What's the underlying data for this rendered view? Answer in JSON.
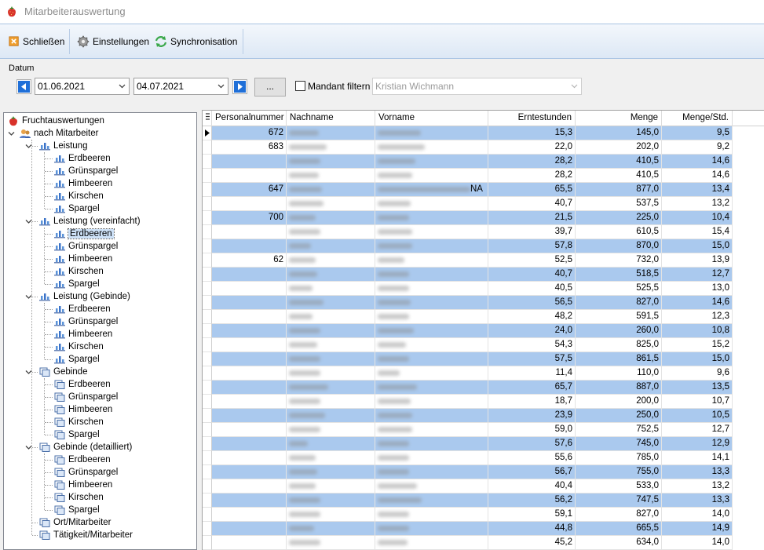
{
  "window": {
    "title": "Mitarbeiterauswertung"
  },
  "toolbar": {
    "close_label": "Schließen",
    "settings_label": "Einstellungen",
    "sync_label": "Synchronisation"
  },
  "filter": {
    "datum_label": "Datum",
    "date_from": "01.06.2021",
    "date_to": "04.07.2021",
    "dots_label": "...",
    "mandant_label": "Mandant filtern",
    "mandant_checked": false,
    "mandant_value": "Kristian Wichmann"
  },
  "tree": {
    "root": "Fruchtauswertungen",
    "by_employee": "nach Mitarbeiter",
    "groups": [
      {
        "label": "Leistung",
        "items": [
          "Erdbeeren",
          "Grünspargel",
          "Himbeeren",
          "Kirschen",
          "Spargel"
        ]
      },
      {
        "label": "Leistung (vereinfacht)",
        "items": [
          "Erdbeeren",
          "Grünspargel",
          "Himbeeren",
          "Kirschen",
          "Spargel"
        ]
      },
      {
        "label": "Leistung (Gebinde)",
        "items": [
          "Erdbeeren",
          "Grünspargel",
          "Himbeeren",
          "Kirschen",
          "Spargel"
        ]
      },
      {
        "label": "Gebinde",
        "items": [
          "Erdbeeren",
          "Grünspargel",
          "Himbeeren",
          "Kirschen",
          "Spargel"
        ]
      },
      {
        "label": "Gebinde (detailliert)",
        "items": [
          "Erdbeeren",
          "Grünspargel",
          "Himbeeren",
          "Kirschen",
          "Spargel"
        ]
      }
    ],
    "extra": [
      "Ort/Mitarbeiter",
      "Tätigkeit/Mitarbeiter"
    ],
    "selected_item": "Erdbeeren"
  },
  "grid": {
    "columns": [
      "Personalnummer",
      "Nachname",
      "Vorname",
      "Erntestunden",
      "Menge",
      "Menge/Std."
    ],
    "rows": [
      {
        "pnr": "672",
        "vorname_suffix": "",
        "stunden": "15,3",
        "menge": "145,0",
        "mps": "9,5"
      },
      {
        "pnr": "683",
        "vorname_suffix": "",
        "stunden": "22,0",
        "menge": "202,0",
        "mps": "9,2"
      },
      {
        "pnr": "",
        "vorname_suffix": "",
        "stunden": "28,2",
        "menge": "410,5",
        "mps": "14,6"
      },
      {
        "pnr": "",
        "vorname_suffix": "",
        "stunden": "28,2",
        "menge": "410,5",
        "mps": "14,6"
      },
      {
        "pnr": "647",
        "vorname_suffix": "NA",
        "stunden": "65,5",
        "menge": "877,0",
        "mps": "13,4"
      },
      {
        "pnr": "",
        "vorname_suffix": "",
        "stunden": "40,7",
        "menge": "537,5",
        "mps": "13,2"
      },
      {
        "pnr": "700",
        "vorname_suffix": "",
        "stunden": "21,5",
        "menge": "225,0",
        "mps": "10,4"
      },
      {
        "pnr": "",
        "vorname_suffix": "",
        "stunden": "39,7",
        "menge": "610,5",
        "mps": "15,4"
      },
      {
        "pnr": "",
        "vorname_suffix": "",
        "stunden": "57,8",
        "menge": "870,0",
        "mps": "15,0"
      },
      {
        "pnr": "62",
        "vorname_suffix": "",
        "stunden": "52,5",
        "menge": "732,0",
        "mps": "13,9"
      },
      {
        "pnr": "",
        "vorname_suffix": "",
        "stunden": "40,7",
        "menge": "518,5",
        "mps": "12,7"
      },
      {
        "pnr": "",
        "vorname_suffix": "",
        "stunden": "40,5",
        "menge": "525,5",
        "mps": "13,0"
      },
      {
        "pnr": "",
        "vorname_suffix": "",
        "stunden": "56,5",
        "menge": "827,0",
        "mps": "14,6"
      },
      {
        "pnr": "",
        "vorname_suffix": "",
        "stunden": "48,2",
        "menge": "591,5",
        "mps": "12,3"
      },
      {
        "pnr": "",
        "vorname_suffix": "",
        "stunden": "24,0",
        "menge": "260,0",
        "mps": "10,8"
      },
      {
        "pnr": "",
        "vorname_suffix": "",
        "stunden": "54,3",
        "menge": "825,0",
        "mps": "15,2"
      },
      {
        "pnr": "",
        "vorname_suffix": "",
        "stunden": "57,5",
        "menge": "861,5",
        "mps": "15,0"
      },
      {
        "pnr": "",
        "vorname_suffix": "",
        "stunden": "11,4",
        "menge": "110,0",
        "mps": "9,6"
      },
      {
        "pnr": "",
        "vorname_suffix": "",
        "stunden": "65,7",
        "menge": "887,0",
        "mps": "13,5"
      },
      {
        "pnr": "",
        "vorname_suffix": "",
        "stunden": "18,7",
        "menge": "200,0",
        "mps": "10,7"
      },
      {
        "pnr": "",
        "vorname_suffix": "",
        "stunden": "23,9",
        "menge": "250,0",
        "mps": "10,5"
      },
      {
        "pnr": "",
        "vorname_suffix": "",
        "stunden": "59,0",
        "menge": "752,5",
        "mps": "12,7"
      },
      {
        "pnr": "",
        "vorname_suffix": "",
        "stunden": "57,6",
        "menge": "745,0",
        "mps": "12,9"
      },
      {
        "pnr": "",
        "vorname_suffix": "",
        "stunden": "55,6",
        "menge": "785,0",
        "mps": "14,1"
      },
      {
        "pnr": "",
        "vorname_suffix": "",
        "stunden": "56,7",
        "menge": "755,0",
        "mps": "13,3"
      },
      {
        "pnr": "",
        "vorname_suffix": "",
        "stunden": "40,4",
        "menge": "533,0",
        "mps": "13,2"
      },
      {
        "pnr": "",
        "vorname_suffix": "",
        "stunden": "56,2",
        "menge": "747,5",
        "mps": "13,3"
      },
      {
        "pnr": "",
        "vorname_suffix": "",
        "stunden": "59,1",
        "menge": "827,0",
        "mps": "14,0"
      },
      {
        "pnr": "",
        "vorname_suffix": "",
        "stunden": "44,8",
        "menge": "665,5",
        "mps": "14,9"
      },
      {
        "pnr": "",
        "vorname_suffix": "",
        "stunden": "45,2",
        "menge": "634,0",
        "mps": "14,0"
      }
    ]
  },
  "colors": {
    "row_alt": "#aac9ee",
    "accent_blue": "#1f6fd8"
  },
  "icons": [
    "strawberry-icon",
    "close-icon",
    "gear-icon",
    "sync-icon",
    "arrow-left-icon",
    "arrow-right-icon",
    "chart-icon",
    "container-icon",
    "users-icon"
  ]
}
